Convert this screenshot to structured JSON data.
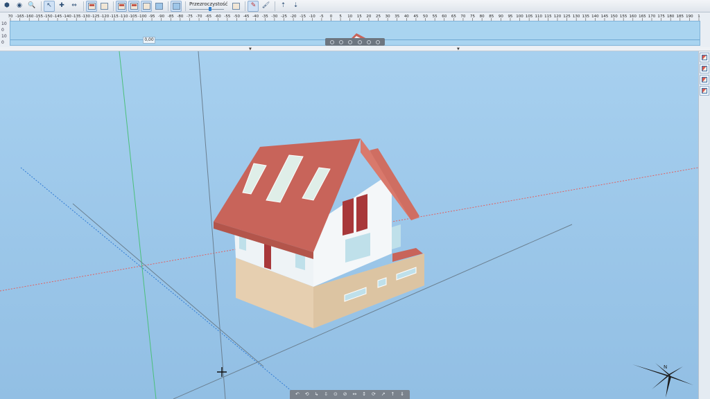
{
  "toolbar": {
    "transparency_label": "Przezroczystość",
    "transparency_level": 0.6,
    "buttons": [
      {
        "name": "view-3d-icon",
        "glyph": "⬢"
      },
      {
        "name": "layers-icon",
        "glyph": "◉"
      },
      {
        "name": "zoom-icon",
        "glyph": "🔍"
      },
      {
        "name": "select-pointer-icon",
        "glyph": "↖"
      },
      {
        "name": "add-element-icon",
        "glyph": "✚"
      },
      {
        "name": "measure-icon",
        "glyph": "⇔"
      }
    ]
  },
  "ruler": {
    "ticks": [
      "70",
      "-165",
      "-160",
      "-155",
      "-150",
      "-145",
      "-140",
      "-135",
      "-130",
      "-125",
      "-120",
      "-115",
      "-110",
      "-105",
      "-100",
      "-95",
      "-90",
      "-85",
      "-80",
      "-75",
      "-70",
      "-65",
      "-60",
      "-55",
      "-50",
      "-45",
      "-40",
      "-35",
      "-30",
      "-25",
      "-20",
      "-15",
      "-10",
      "-5",
      "0",
      "5",
      "10",
      "15",
      "20",
      "25",
      "30",
      "35",
      "40",
      "45",
      "50",
      "55",
      "60",
      "65",
      "70",
      "75",
      "80",
      "85",
      "90",
      "95",
      "100",
      "105",
      "110",
      "115",
      "120",
      "125",
      "130",
      "135",
      "140",
      "145",
      "150",
      "155",
      "160",
      "165",
      "170",
      "175",
      "180",
      "185",
      "190",
      "1"
    ],
    "left_scale": [
      "10",
      "0",
      "10",
      "0"
    ],
    "coordinate_value": "0,00"
  },
  "colors": {
    "sky": "#9dc8ea",
    "roof": "#c8645a",
    "wall": "#eef3f6",
    "basement": "#e6cfb0",
    "window": "#bfe0ea",
    "door": "#a8383a",
    "axis_x": "#e06060",
    "axis_y": "#2f7ad4",
    "axis_z": "#4bbf7a"
  },
  "side_toolbar": {
    "buttons": [
      "view-orientation-icon",
      "section-icon",
      "elevation-icon",
      "render-options-icon"
    ]
  },
  "nav_bar": {
    "glyphs": [
      "↶",
      "⟲",
      "↳",
      "⇩",
      "⊙",
      "⊘",
      "↔",
      "↕",
      "⟳",
      "↗",
      "↑",
      "⇓"
    ]
  },
  "compass": {
    "label": "N"
  }
}
